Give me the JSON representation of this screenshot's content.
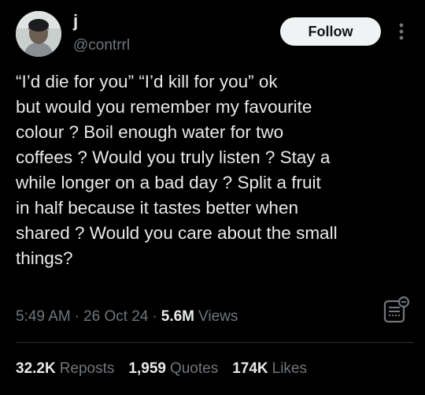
{
  "author": {
    "display_name": "j",
    "handle": "@contrrl",
    "avatar_icon": "profile-photo"
  },
  "follow_button": {
    "label": "Follow"
  },
  "more_icon": "more-vertical-icon",
  "tweet": {
    "text": "“I’d die for you” “I’d kill for you” ok\nbut would you remember my favourite\ncolour ? Boil enough water for two\ncoffees ? Would you truly listen ? Stay a\nwhile longer on a bad day ? Split a fruit\nin half because it tastes better when\nshared ? Would you care about the small\nthings?"
  },
  "meta": {
    "time": "5:49 AM",
    "separator": "·",
    "date": "26 Oct 24",
    "views_count": "5.6M",
    "views_label": "Views"
  },
  "stats": {
    "reposts_count": "32.2K",
    "reposts_label": "Reposts",
    "quotes_count": "1,959",
    "quotes_label": "Quotes",
    "likes_count": "174K",
    "likes_label": "Likes"
  },
  "colors": {
    "background": "#000000",
    "primary_text": "#e7e9ea",
    "secondary_text": "#71767b",
    "button_bg": "#eff3f4",
    "divider": "#2f3336"
  }
}
